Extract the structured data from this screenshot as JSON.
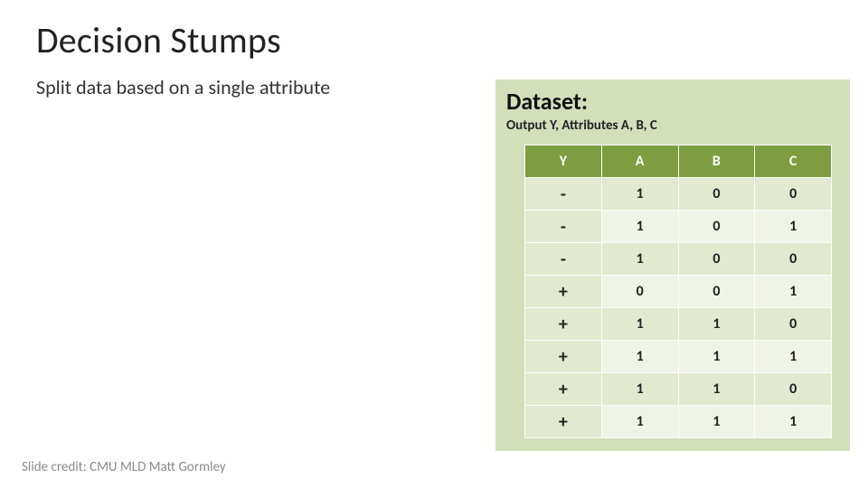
{
  "title": "Decision Stumps",
  "subtitle": "Split data based on a single attribute",
  "panel": {
    "title": "Dataset:",
    "sub": "Output Y, Attributes A, B, C",
    "headers": [
      "Y",
      "A",
      "B",
      "C"
    ],
    "rows": [
      [
        "-",
        "1",
        "0",
        "0"
      ],
      [
        "-",
        "1",
        "0",
        "1"
      ],
      [
        "-",
        "1",
        "0",
        "0"
      ],
      [
        "+",
        "0",
        "0",
        "1"
      ],
      [
        "+",
        "1",
        "1",
        "0"
      ],
      [
        "+",
        "1",
        "1",
        "1"
      ],
      [
        "+",
        "1",
        "1",
        "0"
      ],
      [
        "+",
        "1",
        "1",
        "1"
      ]
    ]
  },
  "footer": "Slide credit: CMU MLD Matt Gormley"
}
